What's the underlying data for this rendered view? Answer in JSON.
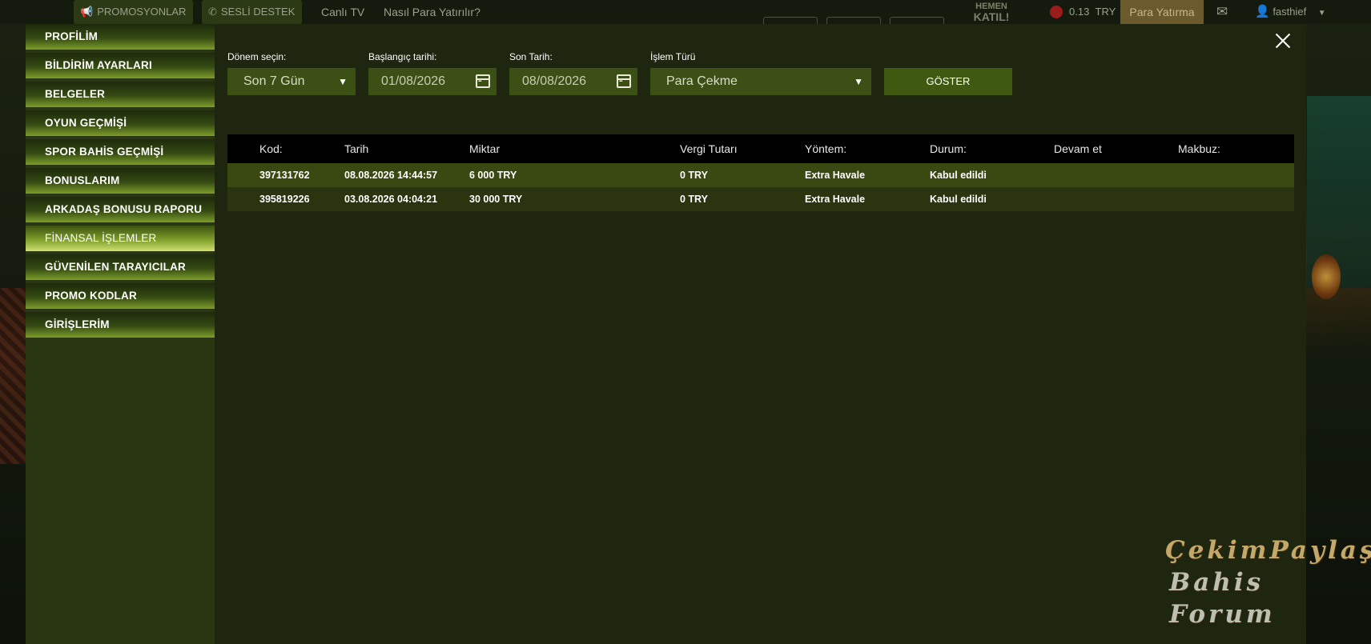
{
  "topbar": {
    "promotions_label": "PROMOSYONLAR",
    "voice_support_label": "SESLİ DESTEK",
    "live_tv_label": "Canlı TV",
    "how_to_deposit_label": "Nasıl Para Yatırılır?",
    "join_line1": "HEMEN",
    "join_line2": "KATIL!",
    "balance_amount": "0.13",
    "balance_currency": "TRY",
    "deposit_label": "Para Yatırma",
    "username": "fasthief"
  },
  "sidebar": {
    "items": [
      {
        "label": "PROFİLİM"
      },
      {
        "label": "BİLDİRİM AYARLARI"
      },
      {
        "label": "BELGELER"
      },
      {
        "label": "OYUN GEÇMİŞİ"
      },
      {
        "label": "SPOR BAHİS GEÇMİŞİ"
      },
      {
        "label": "BONUSLARIM"
      },
      {
        "label": "ARKADAŞ BONUSU RAPORU"
      },
      {
        "label": "FİNANSAL İŞLEMLER"
      },
      {
        "label": "GÜVENİLEN TARAYICILAR"
      },
      {
        "label": "PROMO KODLAR"
      },
      {
        "label": "GİRİŞLERİM"
      }
    ],
    "active_index": 7
  },
  "filters": {
    "period_label": "Dönem seçin:",
    "period_value": "Son 7 Gün",
    "start_label": "Başlangıç tarihi:",
    "start_value": "01/08/2026",
    "end_label": "Son Tarih:",
    "end_value": "08/08/2026",
    "type_label": "İşlem Türü",
    "type_value": "Para Çekme",
    "show_button": "GÖSTER"
  },
  "table": {
    "headers": [
      "Kod:",
      "Tarih",
      "Miktar",
      "Vergi Tutarı",
      "Yöntem:",
      "Durum:",
      "Devam et",
      "Makbuz:"
    ],
    "rows": [
      {
        "code": "397131762",
        "date": "08.08.2026 14:44:57",
        "amount": "6 000 TRY",
        "tax": "0 TRY",
        "method": "Extra Havale",
        "status": "Kabul edildi"
      },
      {
        "code": "395819226",
        "date": "03.08.2026 04:04:21",
        "amount": "30 000 TRY",
        "tax": "0 TRY",
        "method": "Extra Havale",
        "status": "Kabul edildi"
      }
    ]
  },
  "watermark": {
    "line1": "ÇekimPaylaş",
    "line2": "Bahis Forum"
  },
  "colors": {
    "modal_bg": "#1e2610",
    "menu_green": "#7c9c2a",
    "active_menu": "#cfe070",
    "header_black": "#000000",
    "row_highlight": "#3a4912"
  }
}
